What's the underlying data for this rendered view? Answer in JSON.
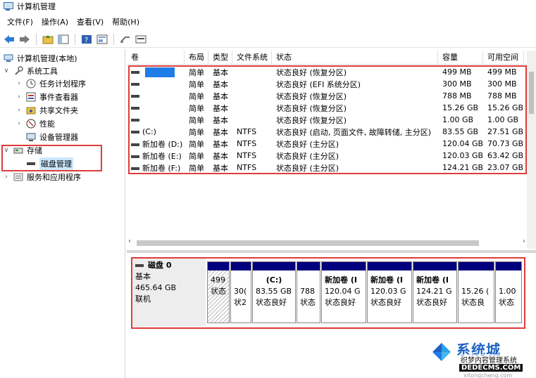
{
  "window": {
    "title": "计算机管理"
  },
  "menu": [
    "文件(F)",
    "操作(A)",
    "查看(V)",
    "帮助(H)"
  ],
  "tree": {
    "root": "计算机管理(本地)",
    "items": [
      {
        "label": "系统工具",
        "level": 1,
        "expander": "∨"
      },
      {
        "label": "任务计划程序",
        "level": 2,
        "expander": "›"
      },
      {
        "label": "事件查看器",
        "level": 2,
        "expander": "›"
      },
      {
        "label": "共享文件夹",
        "level": 2,
        "expander": "›"
      },
      {
        "label": "性能",
        "level": 2,
        "expander": "›"
      },
      {
        "label": "设备管理器",
        "level": 2,
        "expander": ""
      },
      {
        "label": "存储",
        "level": 1,
        "expander": "∨"
      },
      {
        "label": "磁盘管理",
        "level": 2,
        "expander": ""
      },
      {
        "label": "服务和应用程序",
        "level": 1,
        "expander": "›"
      }
    ]
  },
  "columns": [
    "卷",
    "布局",
    "类型",
    "文件系统",
    "状态",
    "容量",
    "可用空间",
    "%"
  ],
  "volumes": [
    {
      "name": "",
      "layout": "简单",
      "type": "基本",
      "fs": "",
      "status": "状态良好 (恢复分区)",
      "capacity": "499 MB",
      "free": "499 MB"
    },
    {
      "name": "",
      "layout": "简单",
      "type": "基本",
      "fs": "",
      "status": "状态良好 (EFI 系统分区)",
      "capacity": "300 MB",
      "free": "300 MB"
    },
    {
      "name": "",
      "layout": "简单",
      "type": "基本",
      "fs": "",
      "status": "状态良好 (恢复分区)",
      "capacity": "788 MB",
      "free": "788 MB"
    },
    {
      "name": "",
      "layout": "简单",
      "type": "基本",
      "fs": "",
      "status": "状态良好 (恢复分区)",
      "capacity": "15.26 GB",
      "free": "15.26 GB"
    },
    {
      "name": "",
      "layout": "简单",
      "type": "基本",
      "fs": "",
      "status": "状态良好 (恢复分区)",
      "capacity": "1.00 GB",
      "free": "1.00 GB"
    },
    {
      "name": "(C:)",
      "layout": "简单",
      "type": "基本",
      "fs": "NTFS",
      "status": "状态良好 (启动, 页面文件, 故障转储, 主分区)",
      "capacity": "83.55 GB",
      "free": "27.51 GB"
    },
    {
      "name": "新加卷 (D:)",
      "layout": "简单",
      "type": "基本",
      "fs": "NTFS",
      "status": "状态良好 (主分区)",
      "capacity": "120.04 GB",
      "free": "70.73 GB"
    },
    {
      "name": "新加卷 (E:)",
      "layout": "简单",
      "type": "基本",
      "fs": "NTFS",
      "status": "状态良好 (主分区)",
      "capacity": "120.03 GB",
      "free": "63.42 GB"
    },
    {
      "name": "新加卷 (F:)",
      "layout": "简单",
      "type": "基本",
      "fs": "NTFS",
      "status": "状态良好 (主分区)",
      "capacity": "124.21 GB",
      "free": "23.07 GB"
    }
  ],
  "disk": {
    "name": "磁盘 0",
    "type": "基本",
    "size": "465.64 GB",
    "status": "联机",
    "partitions": [
      {
        "title": "",
        "size": "499",
        "status": "状态"
      },
      {
        "title": "",
        "size": "30(",
        "status": "状2"
      },
      {
        "title": "(C:)",
        "size": "83.55 GB",
        "status": "状态良好"
      },
      {
        "title": "",
        "size": "788",
        "status": "状态"
      },
      {
        "title": "新加卷 (I",
        "size": "120.04 G",
        "status": "状态良好"
      },
      {
        "title": "新加卷 (I",
        "size": "120.03 G",
        "status": "状态良好"
      },
      {
        "title": "新加卷 (I",
        "size": "124.21 G",
        "status": "状态良好"
      },
      {
        "title": "",
        "size": "15.26 (",
        "status": "状态良"
      },
      {
        "title": "",
        "size": "1.00",
        "status": "状态"
      }
    ]
  },
  "watermark": {
    "brand": "系统城",
    "slogan": "织梦内容管理系统",
    "url": "DEDECMS.COM",
    "url2": "xitongcheng.com"
  },
  "colors": {
    "accent_red": "#e03b3b",
    "partition_bar": "#00007e",
    "selection": "#1e7de6"
  }
}
